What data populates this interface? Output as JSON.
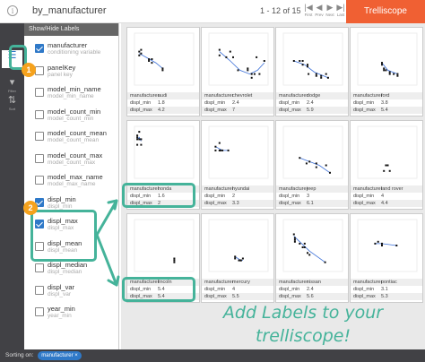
{
  "header": {
    "title": "by_manufacturer",
    "pager": "1 - 12 of 15",
    "nav": [
      {
        "glyph": "|◀",
        "label": "First"
      },
      {
        "glyph": "◀",
        "label": "Prev"
      },
      {
        "glyph": "▶",
        "label": "Next"
      },
      {
        "glyph": "▶|",
        "label": "Last"
      }
    ],
    "brand": "Trelliscope"
  },
  "rail": [
    {
      "icon": "labels-icon",
      "glyph": "☰",
      "label": "",
      "active": true
    },
    {
      "icon": "filter-icon",
      "glyph": "▾",
      "label": "Filter",
      "active": false
    },
    {
      "icon": "sort-icon",
      "glyph": "⇅",
      "label": "Sort",
      "active": false
    }
  ],
  "labels_panel": {
    "heading": "Show/Hide Labels",
    "items": [
      {
        "name": "manufacturer",
        "desc": "conditioning variable",
        "checked": true
      },
      {
        "name": "panelKey",
        "desc": "panel key",
        "checked": false
      },
      {
        "name": "model_min_name",
        "desc": "model_min_name",
        "checked": false
      },
      {
        "name": "model_count_min",
        "desc": "model_count_min",
        "checked": false
      },
      {
        "name": "model_count_mean",
        "desc": "model_count_mean",
        "checked": false
      },
      {
        "name": "model_count_max",
        "desc": "model_count_max",
        "checked": false
      },
      {
        "name": "model_max_name",
        "desc": "model_max_name",
        "checked": false
      },
      {
        "name": "displ_min",
        "desc": "displ_min",
        "checked": true
      },
      {
        "name": "displ_max",
        "desc": "displ_max",
        "checked": true
      },
      {
        "name": "displ_mean",
        "desc": "displ_mean",
        "checked": false
      },
      {
        "name": "displ_median",
        "desc": "displ_median",
        "checked": false
      },
      {
        "name": "displ_var",
        "desc": "displ_var",
        "checked": false
      },
      {
        "name": "year_min",
        "desc": "year_min",
        "checked": false
      }
    ]
  },
  "label_keys": [
    "manufacturer",
    "displ_min",
    "displ_max"
  ],
  "panels": [
    {
      "manufacturer": "audi",
      "displ_min": "1.8",
      "displ_max": "4.2",
      "points": [
        [
          1.8,
          29
        ],
        [
          1.8,
          27
        ],
        [
          2.0,
          30
        ],
        [
          2.0,
          28
        ],
        [
          2.8,
          24
        ],
        [
          2.8,
          25
        ],
        [
          3.1,
          23
        ],
        [
          3.1,
          25
        ],
        [
          4.2,
          20
        ],
        [
          4.2,
          19
        ]
      ],
      "curve": [
        [
          1.8,
          28
        ],
        [
          2.5,
          26
        ],
        [
          3.5,
          23
        ],
        [
          4.2,
          20
        ]
      ]
    },
    {
      "manufacturer": "chevrolet",
      "displ_min": "2.4",
      "displ_max": "7",
      "has_star": true,
      "points": [
        [
          2.4,
          30
        ],
        [
          2.4,
          27
        ],
        [
          3.1,
          26
        ],
        [
          3.5,
          29
        ],
        [
          3.8,
          26
        ],
        [
          4.3,
          19
        ],
        [
          5.3,
          20
        ],
        [
          5.3,
          19
        ],
        [
          5.7,
          17
        ],
        [
          5.7,
          15
        ],
        [
          6.0,
          17
        ],
        [
          6.2,
          26
        ],
        [
          6.5,
          17
        ],
        [
          7.0,
          24
        ]
      ],
      "curve": [
        [
          2.4,
          29
        ],
        [
          3.5,
          24
        ],
        [
          4.5,
          19
        ],
        [
          5.5,
          17
        ],
        [
          6.3,
          19
        ],
        [
          7.0,
          23
        ]
      ]
    },
    {
      "manufacturer": "dodge",
      "displ_min": "2.4",
      "displ_max": "5.9",
      "points": [
        [
          2.4,
          24
        ],
        [
          3.0,
          24
        ],
        [
          3.3,
          24
        ],
        [
          3.3,
          22
        ],
        [
          3.8,
          22
        ],
        [
          3.8,
          21
        ],
        [
          3.9,
          17
        ],
        [
          4.7,
          17
        ],
        [
          4.7,
          16
        ],
        [
          5.2,
          15
        ],
        [
          5.2,
          16
        ],
        [
          5.9,
          15
        ],
        [
          5.7,
          17
        ]
      ],
      "curve": [
        [
          2.4,
          24
        ],
        [
          3.5,
          22
        ],
        [
          4.5,
          18
        ],
        [
          5.9,
          15
        ]
      ]
    },
    {
      "manufacturer": "ford",
      "displ_min": "3.8",
      "displ_max": "5.4",
      "points": [
        [
          3.8,
          23
        ],
        [
          3.8,
          22
        ],
        [
          4.0,
          20
        ],
        [
          4.0,
          19
        ],
        [
          4.2,
          19
        ],
        [
          4.6,
          18
        ],
        [
          4.6,
          17
        ],
        [
          5.0,
          17
        ],
        [
          5.4,
          16
        ],
        [
          5.4,
          17
        ]
      ],
      "curve": [
        [
          3.8,
          23
        ],
        [
          4.4,
          19
        ],
        [
          5.4,
          17
        ]
      ]
    },
    {
      "manufacturer": "honda",
      "displ_min": "1.6",
      "displ_max": "2",
      "points": [
        [
          1.6,
          33
        ],
        [
          1.6,
          32
        ],
        [
          1.6,
          34
        ],
        [
          1.6,
          29
        ],
        [
          1.8,
          36
        ],
        [
          1.8,
          32
        ],
        [
          2.0,
          29
        ],
        [
          2.0,
          32
        ]
      ],
      "curve": [
        [
          1.6,
          32
        ],
        [
          1.8,
          33
        ],
        [
          2.0,
          31
        ]
      ]
    },
    {
      "manufacturer": "hyundai",
      "displ_min": "2",
      "displ_max": "3.3",
      "points": [
        [
          2.0,
          26
        ],
        [
          2.0,
          28
        ],
        [
          2.4,
          26
        ],
        [
          2.4,
          30
        ],
        [
          2.5,
          26
        ],
        [
          2.7,
          26
        ],
        [
          3.3,
          26
        ]
      ],
      "curve": [
        [
          2.0,
          28
        ],
        [
          2.7,
          26
        ],
        [
          3.3,
          26
        ]
      ]
    },
    {
      "manufacturer": "jeep",
      "displ_min": "3",
      "displ_max": "6.1",
      "points": [
        [
          3.0,
          22
        ],
        [
          3.7,
          19
        ],
        [
          4.0,
          20
        ],
        [
          4.7,
          19
        ],
        [
          4.7,
          17
        ],
        [
          5.7,
          18
        ],
        [
          6.1,
          14
        ]
      ],
      "curve": [
        [
          3.0,
          22
        ],
        [
          4.0,
          20
        ],
        [
          5.0,
          18
        ],
        [
          6.1,
          14
        ]
      ]
    },
    {
      "manufacturer": "land rover",
      "displ_min": "4",
      "displ_max": "4.4",
      "points": [
        [
          4.0,
          15
        ],
        [
          4.2,
          18
        ],
        [
          4.4,
          18
        ],
        [
          4.6,
          15
        ]
      ],
      "curve": []
    },
    {
      "manufacturer": "lincoln",
      "displ_min": "5.4",
      "displ_max": "5.4",
      "points": [
        [
          5.4,
          17
        ],
        [
          5.4,
          18
        ],
        [
          5.4,
          16
        ]
      ],
      "curve": []
    },
    {
      "manufacturer": "mercury",
      "displ_min": "4",
      "displ_max": "5.5",
      "points": [
        [
          4.0,
          19
        ],
        [
          4.0,
          18
        ],
        [
          4.4,
          17
        ],
        [
          4.6,
          17
        ],
        [
          4.6,
          17
        ],
        [
          4.8,
          18
        ]
      ],
      "curve": [
        [
          4.0,
          19
        ],
        [
          4.6,
          17
        ],
        [
          4.8,
          17
        ]
      ]
    },
    {
      "manufacturer": "nissan",
      "displ_min": "2.4",
      "displ_max": "5.6",
      "points": [
        [
          2.4,
          31
        ],
        [
          2.5,
          27
        ],
        [
          2.5,
          28
        ],
        [
          2.5,
          29
        ],
        [
          3.0,
          26
        ],
        [
          3.3,
          24
        ],
        [
          3.5,
          26
        ],
        [
          3.5,
          24
        ],
        [
          3.8,
          21
        ],
        [
          4.0,
          20
        ],
        [
          5.6,
          16
        ]
      ],
      "curve": [
        [
          2.4,
          30
        ],
        [
          3.0,
          27
        ],
        [
          4.0,
          22
        ],
        [
          5.6,
          16
        ]
      ]
    },
    {
      "manufacturer": "pontiac",
      "displ_min": "3.1",
      "displ_max": "5.3",
      "points": [
        [
          3.1,
          26
        ],
        [
          3.4,
          27
        ],
        [
          3.8,
          26
        ],
        [
          3.8,
          25
        ],
        [
          5.3,
          25
        ]
      ],
      "curve": [
        [
          3.1,
          26
        ],
        [
          3.8,
          26
        ],
        [
          5.3,
          25
        ]
      ]
    }
  ],
  "annotation": {
    "line1": "Add Labels to your",
    "line2": "trelliscope!"
  },
  "callouts": [
    "1",
    "2"
  ],
  "footer": {
    "sorting_label": "Sorting on:",
    "sort_pill": "manufacturer"
  },
  "colors": {
    "accent": "#2f79c8",
    "brand": "#f06033",
    "highlight": "#45b39a",
    "badge": "#f5a21d",
    "rail": "#414145"
  }
}
